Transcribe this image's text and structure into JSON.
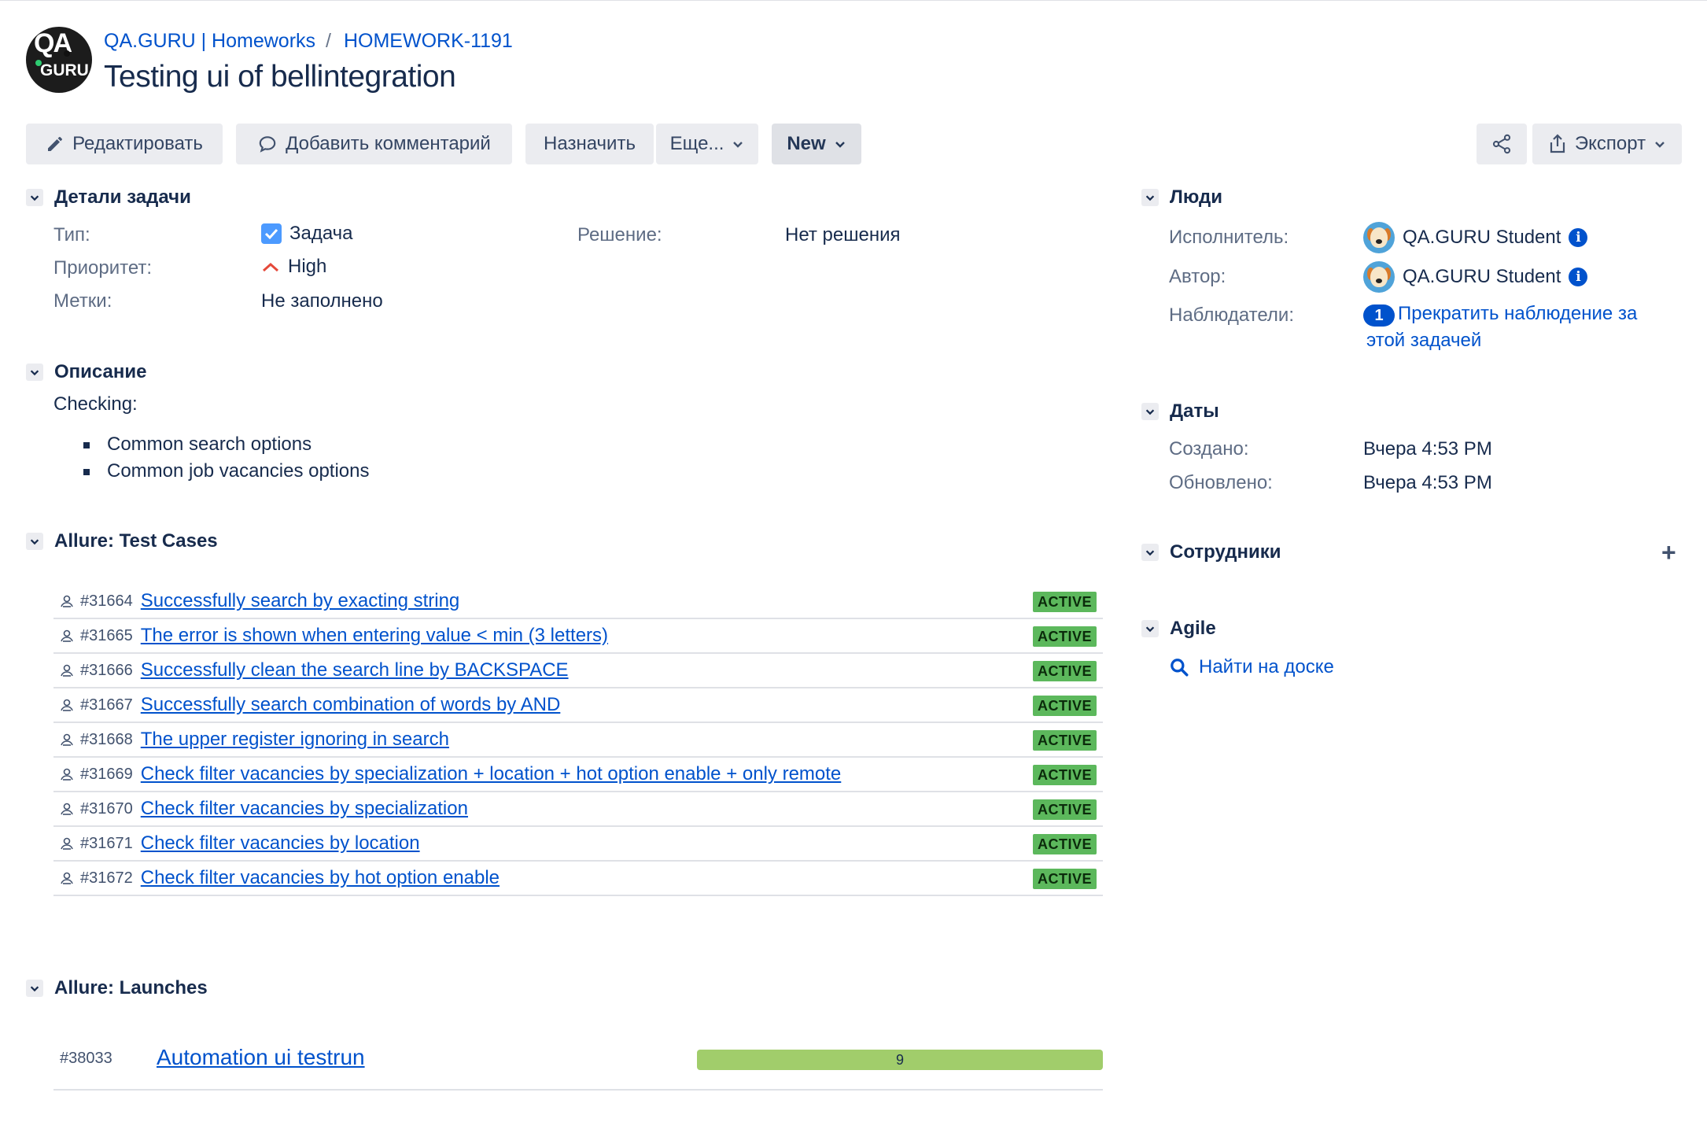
{
  "breadcrumb": {
    "project": "QA.GURU | Homeworks",
    "separator": "/",
    "issue_key": "HOMEWORK-1191"
  },
  "logo": {
    "line1": "QA",
    "line2": "GURU"
  },
  "issue": {
    "title": "Testing ui of bellintegration"
  },
  "toolbar": {
    "edit": "Редактировать",
    "comment": "Добавить комментарий",
    "assign": "Назначить",
    "more": "Еще...",
    "status": "New",
    "export": "Экспорт"
  },
  "details": {
    "header": "Детали задачи",
    "type_label": "Тип:",
    "type_value": "Задача",
    "priority_label": "Приоритет:",
    "priority_value": "High",
    "labels_label": "Метки:",
    "labels_value": "Не заполнено",
    "resolution_label": "Решение:",
    "resolution_value": "Нет решения"
  },
  "description": {
    "header": "Описание",
    "intro": "Checking:",
    "items": [
      "Common search options",
      "Common job vacancies options"
    ]
  },
  "test_cases": {
    "header": "Allure: Test Cases",
    "rows": [
      {
        "id": "#31664",
        "name": "Successfully search by exacting string",
        "status": "ACTIVE"
      },
      {
        "id": "#31665",
        "name": "The error is shown when entering value < min (3 letters)",
        "status": "ACTIVE"
      },
      {
        "id": "#31666",
        "name": "Successfully clean the search line by BACKSPACE",
        "status": "ACTIVE"
      },
      {
        "id": "#31667",
        "name": "Successfully search combination of words by AND",
        "status": "ACTIVE"
      },
      {
        "id": "#31668",
        "name": "The upper register ignoring in search",
        "status": "ACTIVE"
      },
      {
        "id": "#31669",
        "name": "Check filter vacancies by specialization + location + hot option enable + only remote",
        "status": "ACTIVE"
      },
      {
        "id": "#31670",
        "name": "Check filter vacancies by specialization",
        "status": "ACTIVE"
      },
      {
        "id": "#31671",
        "name": "Check filter vacancies by location",
        "status": "ACTIVE"
      },
      {
        "id": "#31672",
        "name": "Check filter vacancies by hot option enable",
        "status": "ACTIVE"
      }
    ]
  },
  "launches": {
    "header": "Allure: Launches",
    "rows": [
      {
        "id": "#38033",
        "name": "Automation ui testrun",
        "count": "9"
      }
    ]
  },
  "people": {
    "header": "Люди",
    "assignee_label": "Исполнитель:",
    "assignee_value": "QA.GURU Student",
    "reporter_label": "Автор:",
    "reporter_value": "QA.GURU Student",
    "watchers_label": "Наблюдатели:",
    "watchers_count": "1",
    "watch_link_line1": "Прекратить наблюдение за",
    "watch_link_line2": "этой задачей"
  },
  "dates": {
    "header": "Даты",
    "created_label": "Создано:",
    "created_value": "Вчера 4:53 PM",
    "updated_label": "Обновлено:",
    "updated_value": "Вчера 4:53 PM"
  },
  "collaborators": {
    "header": "Сотрудники",
    "add": "+"
  },
  "agile": {
    "header": "Agile",
    "find_on_board": "Найти на доске"
  },
  "colors": {
    "link": "#0052cc",
    "active_badge": "#5cb85c",
    "launch_bar": "#a1cd6b",
    "priority_high": "#e5493a",
    "checkbox": "#4c9aff"
  }
}
